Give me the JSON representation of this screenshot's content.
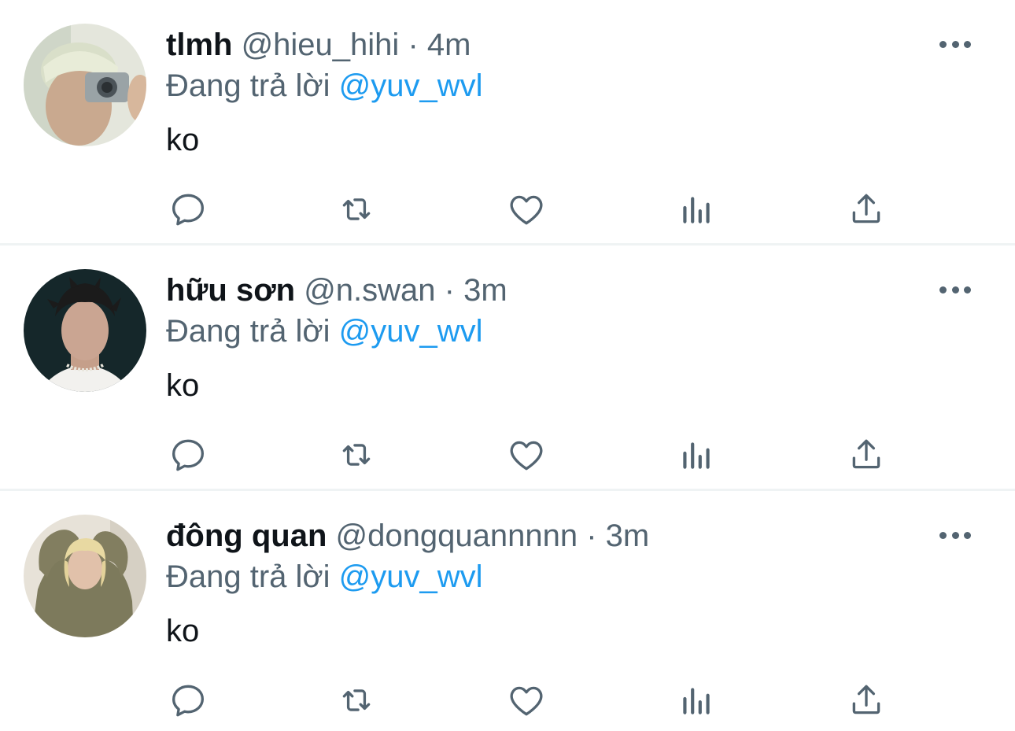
{
  "tweets": [
    {
      "name": "tlmh",
      "handle": "@hieu_hihi",
      "separator": "·",
      "time": "4m",
      "replying_prefix": "Đang trả lời",
      "replying_to": "@yuv_wvl",
      "text": "ko",
      "avatar": "young man holding camera, light background"
    },
    {
      "name": "hữu sơn",
      "handle": "@n.swan",
      "separator": "·",
      "time": "3m",
      "replying_prefix": "Đang trả lời",
      "replying_to": "@yuv_wvl",
      "text": "ko",
      "avatar": "young man with dark hair, dark background, pearl necklace"
    },
    {
      "name": "đông quan",
      "handle": "@dongquannnnn",
      "separator": "·",
      "time": "3m",
      "replying_prefix": "Đang trả lời",
      "replying_to": "@yuv_wvl",
      "text": "ko",
      "avatar": "blond young man in olive hoodie"
    }
  ],
  "action_icons": [
    "reply-icon",
    "retweet-icon",
    "like-icon",
    "views-icon",
    "share-icon"
  ],
  "colors": {
    "text_primary": "#0f1419",
    "text_secondary": "#536471",
    "link": "#1d9bf0",
    "divider": "#eff3f4"
  }
}
